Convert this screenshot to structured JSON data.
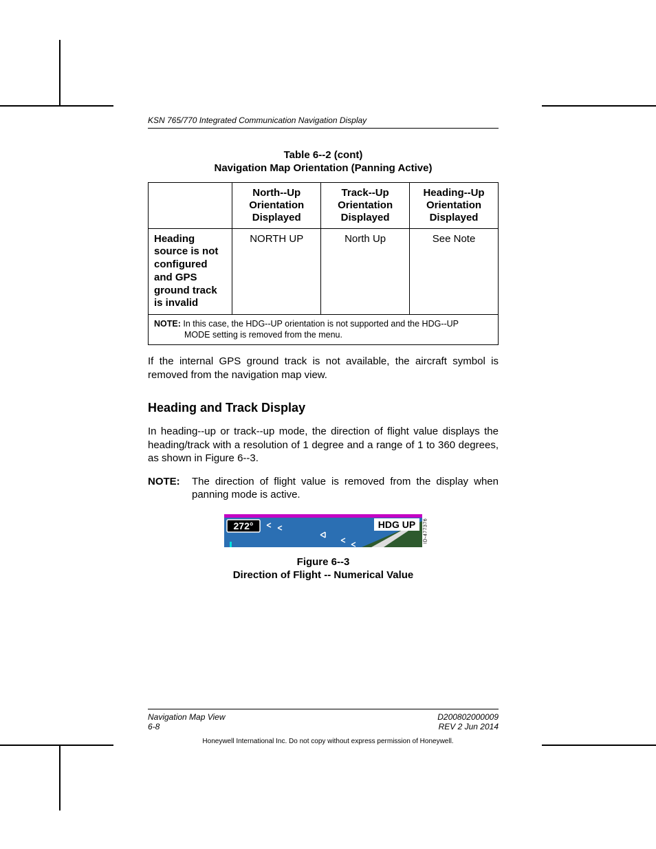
{
  "header": {
    "running": "KSN 765/770 Integrated Communication Navigation Display"
  },
  "table": {
    "caption_line1": "Table 6--2 (cont)",
    "caption_line2": "Navigation Map Orientation (Panning Active)",
    "headers": {
      "c1": "",
      "c2": "North--Up Orientation Displayed",
      "c3": "Track--Up Orientation Displayed",
      "c4": "Heading--Up Orientation Displayed"
    },
    "row": {
      "label": "Heading source is not configured and GPS ground track is invalid",
      "c2": "NORTH UP",
      "c3": "North Up",
      "c4": "See Note"
    },
    "note_label": "NOTE:",
    "note_text_a": "In this case, the HDG--UP orientation is not supported and the HDG--UP",
    "note_text_b": "MODE setting is removed from the menu."
  },
  "body": {
    "para1": "If the internal GPS ground track is not available, the aircraft symbol is removed from the navigation map view.",
    "heading": "Heading and Track Display",
    "para2": "In heading--up or track--up mode, the direction of flight value displays the heading/track with a resolution of 1 degree and a range of 1 to 360 degrees, as shown in Figure 6--3.",
    "note_label": "NOTE:",
    "note_text": "The direction of flight value is removed from the display when panning mode is active."
  },
  "figure": {
    "heading_value": "272°",
    "mode_label": "HDG UP",
    "id_tag": "ID-477376",
    "caption_line1": "Figure 6--3",
    "caption_line2": "Direction of Flight -- Numerical Value"
  },
  "footer": {
    "left1": "Navigation Map View",
    "left2": "6-8",
    "right1": "D200802000009",
    "right2": "REV 2   Jun 2014",
    "copyright": "Honeywell International Inc. Do not copy without express permission of Honeywell."
  }
}
